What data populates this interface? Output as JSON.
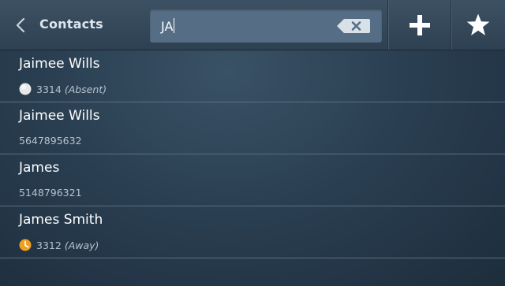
{
  "header": {
    "back_label": "Contacts",
    "search_value": "JA"
  },
  "contacts": [
    {
      "name": "Jaimee Wills",
      "number": "3314",
      "status": "(Absent)",
      "status_kind": "absent",
      "status_color": "#e8e8e8"
    },
    {
      "name": "Jaimee Wills",
      "number": "5647895632",
      "status": "",
      "status_kind": "none"
    },
    {
      "name": "James",
      "number": "5148796321",
      "status": "",
      "status_kind": "none"
    },
    {
      "name": "James Smith",
      "number": "3312",
      "status": "(Away)",
      "status_kind": "away",
      "status_color": "#f0a020"
    }
  ],
  "icons": {
    "back": "chevron-left-icon",
    "clear": "backspace-clear-icon",
    "add": "plus-icon",
    "favorites": "star-icon"
  },
  "colors": {
    "background": "#2a3f52",
    "search_field": "#556e85",
    "away": "#f0a020",
    "absent": "#e8e8e8"
  }
}
